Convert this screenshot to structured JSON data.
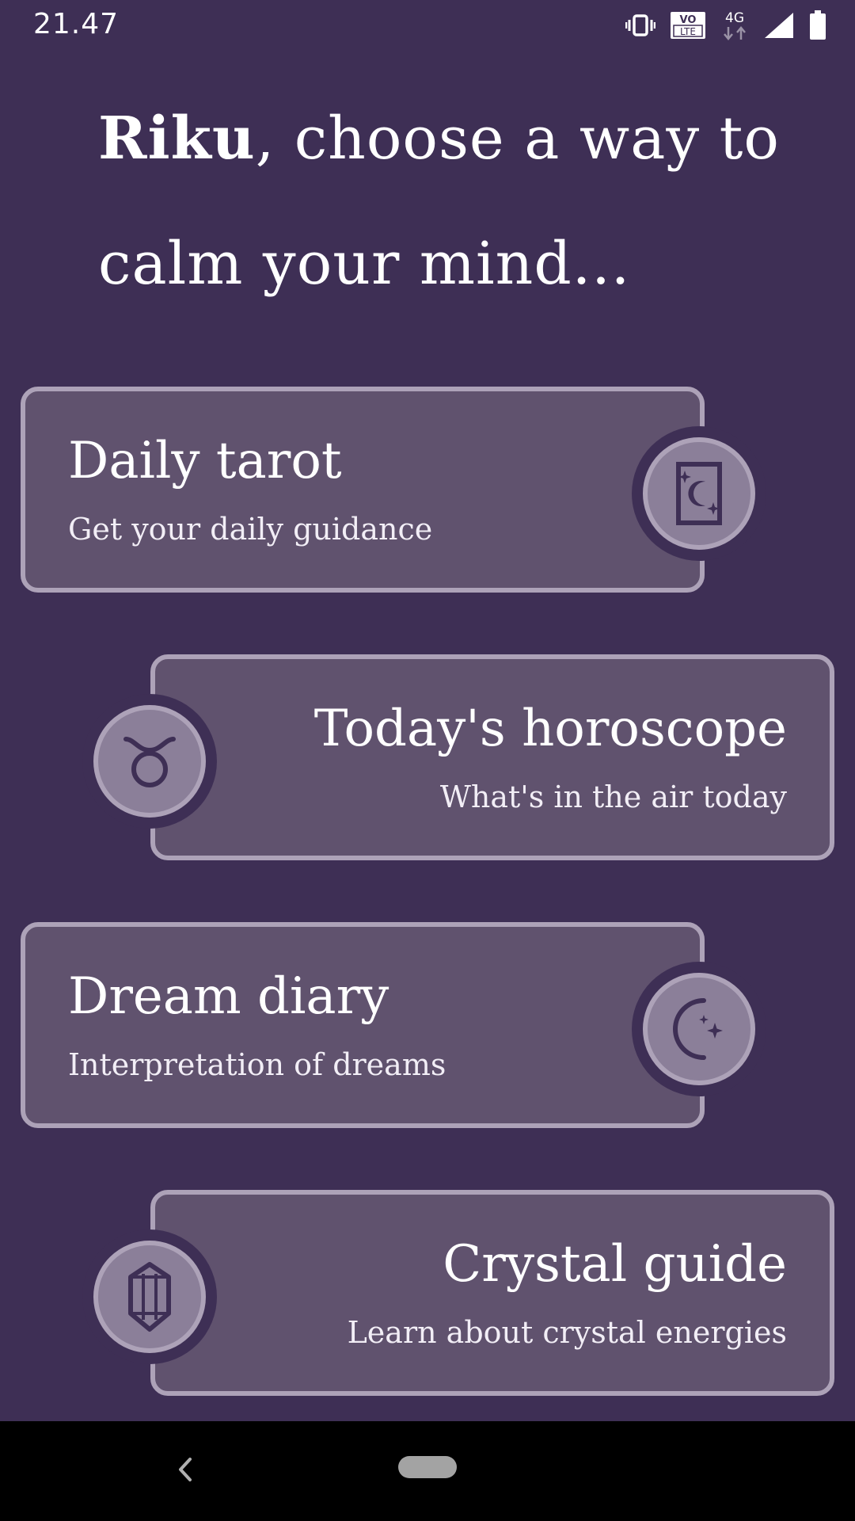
{
  "status_bar": {
    "time": "21.47",
    "icons": [
      "vibrate-icon",
      "volte-icon",
      "4g-data-icon",
      "signal-icon",
      "battery-icon"
    ],
    "volte_label_top": "VO",
    "volte_label_bottom": "LTE",
    "network_label": "4G"
  },
  "headline": {
    "name": "Riku",
    "text": ", choose a way to calm your mind..."
  },
  "cards": [
    {
      "title": "Daily tarot",
      "subtitle": "Get your daily guidance",
      "icon": "tarot-card-icon"
    },
    {
      "title": "Today's horoscope",
      "subtitle": "What's in the air today",
      "icon": "taurus-sign-icon"
    },
    {
      "title": "Dream diary",
      "subtitle": "Interpretation of dreams",
      "icon": "moon-stars-icon"
    },
    {
      "title": "Crystal guide",
      "subtitle": "Learn about crystal energies",
      "icon": "crystal-icon"
    }
  ],
  "nav_bar": {
    "icons": [
      "back-icon",
      "home-pill-icon"
    ]
  },
  "colors": {
    "background": "#3e2f55",
    "card": "#60526e",
    "card_border": "#ada2b8",
    "badge_fill": "#8b7f99",
    "icon_ink": "#3e2f55"
  }
}
